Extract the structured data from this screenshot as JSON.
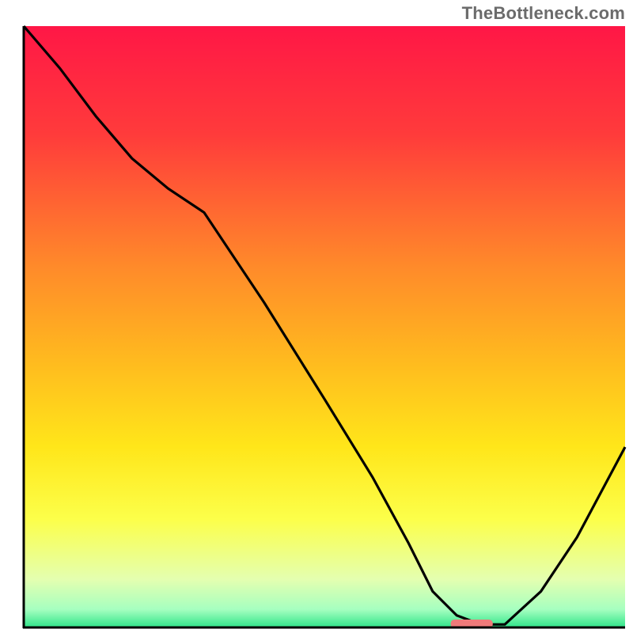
{
  "watermark": "TheBottleneck.com",
  "chart_data": {
    "type": "line",
    "title": "",
    "xlabel": "",
    "ylabel": "",
    "xlim": [
      0,
      100
    ],
    "ylim": [
      0,
      100
    ],
    "grid": false,
    "legend": false,
    "gradient_stops": [
      {
        "offset": 0.0,
        "color": "#ff1746"
      },
      {
        "offset": 0.18,
        "color": "#ff3b3b"
      },
      {
        "offset": 0.4,
        "color": "#ff8a2a"
      },
      {
        "offset": 0.55,
        "color": "#ffb81f"
      },
      {
        "offset": 0.7,
        "color": "#ffe61a"
      },
      {
        "offset": 0.82,
        "color": "#fcff4a"
      },
      {
        "offset": 0.92,
        "color": "#e4ffb0"
      },
      {
        "offset": 0.97,
        "color": "#a6ffc0"
      },
      {
        "offset": 1.0,
        "color": "#2fe489"
      }
    ],
    "series": [
      {
        "name": "bottleneck-curve",
        "x": [
          0,
          6,
          12,
          18,
          24,
          30,
          40,
          50,
          58,
          64,
          68,
          72,
          76,
          80,
          86,
          92,
          100
        ],
        "y": [
          100,
          93,
          85,
          78,
          73,
          69,
          54,
          38,
          25,
          14,
          6,
          2,
          0.5,
          0.5,
          6,
          15,
          30
        ]
      }
    ],
    "marker": {
      "name": "optimal-segment",
      "x0": 71,
      "x1": 78,
      "y": 0.6,
      "color": "#ef7a7a"
    },
    "axes_color": "#000000",
    "axes_width": 3
  }
}
